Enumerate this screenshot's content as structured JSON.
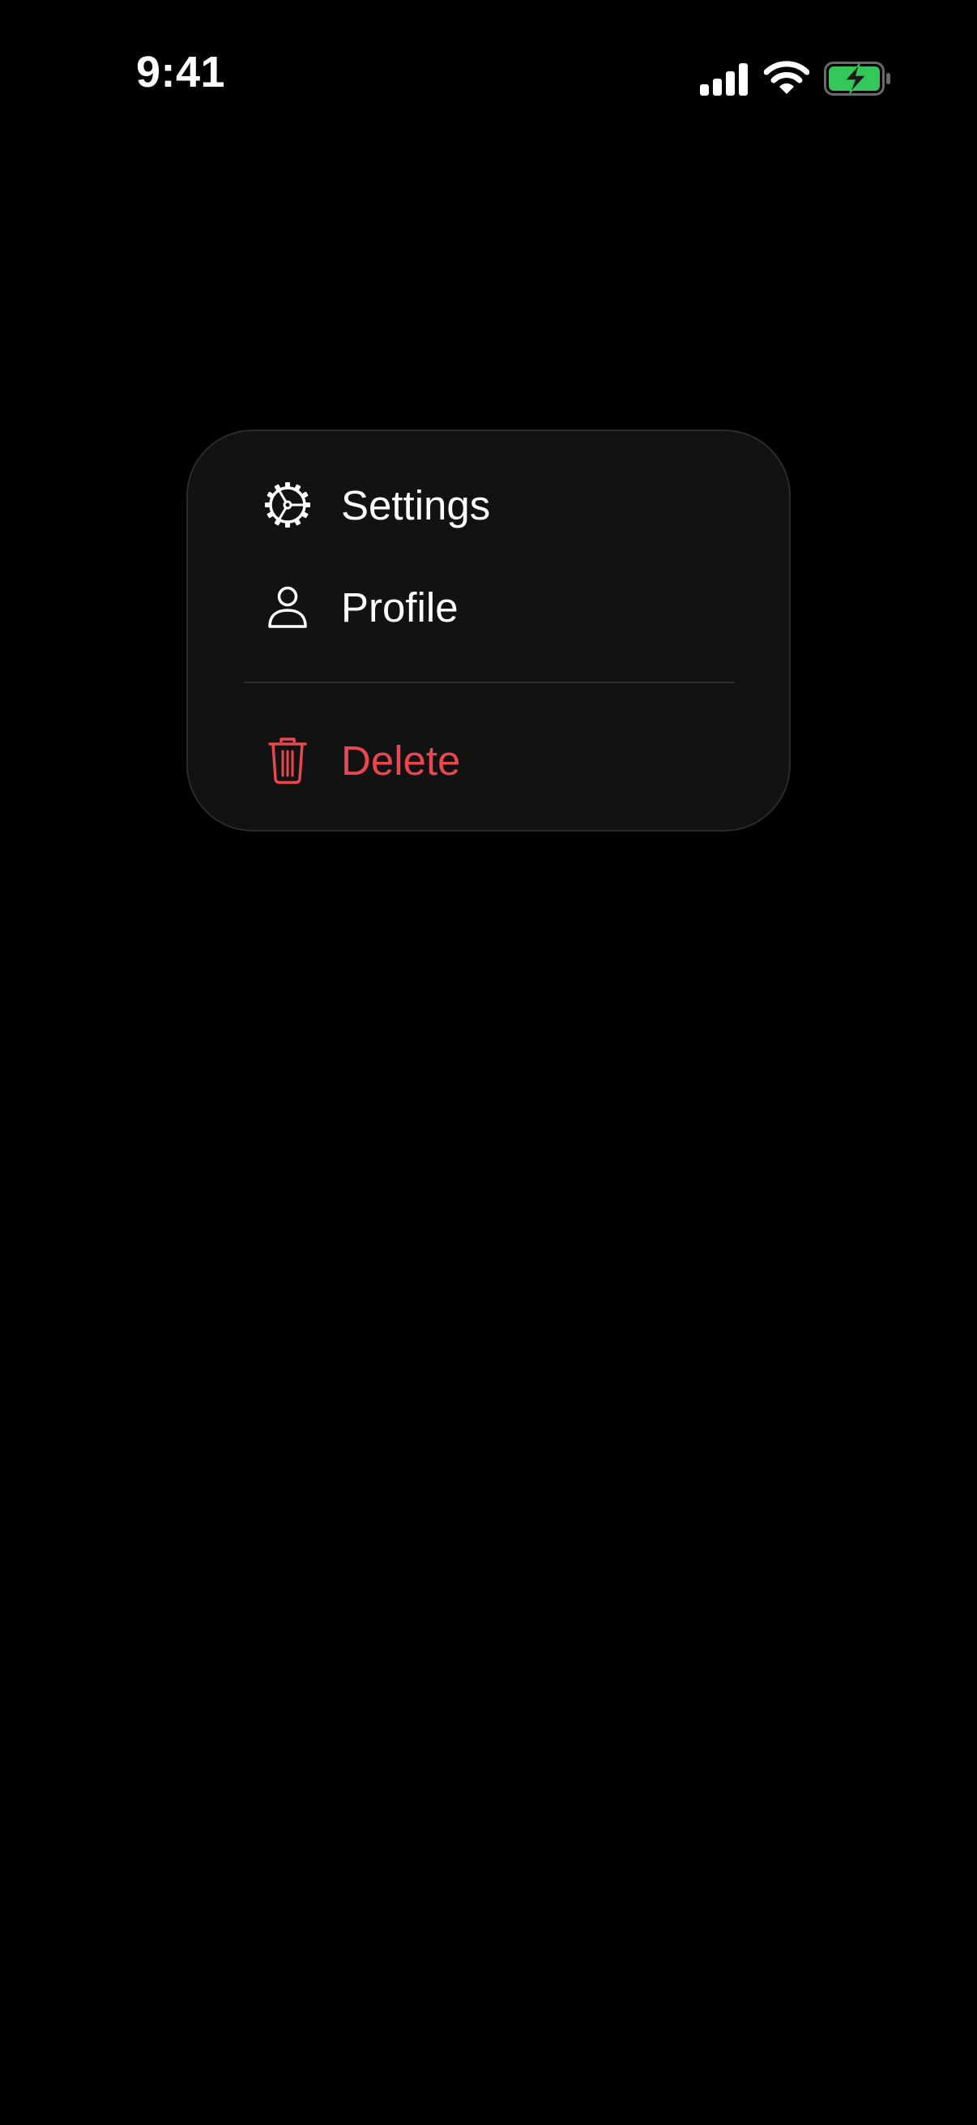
{
  "status_bar": {
    "time": "9:41",
    "signal_icon": "cellular-signal-icon",
    "wifi_icon": "wifi-icon",
    "battery_icon": "battery-charging-icon",
    "battery_color": "#34c759"
  },
  "context_menu": {
    "items": [
      {
        "label": "Settings",
        "icon": "gear-icon"
      },
      {
        "label": "Profile",
        "icon": "person-icon"
      },
      {
        "label": "Delete",
        "icon": "trash-icon",
        "destructive": true
      }
    ],
    "background": "#121212",
    "destructive_color": "#e9474f"
  }
}
